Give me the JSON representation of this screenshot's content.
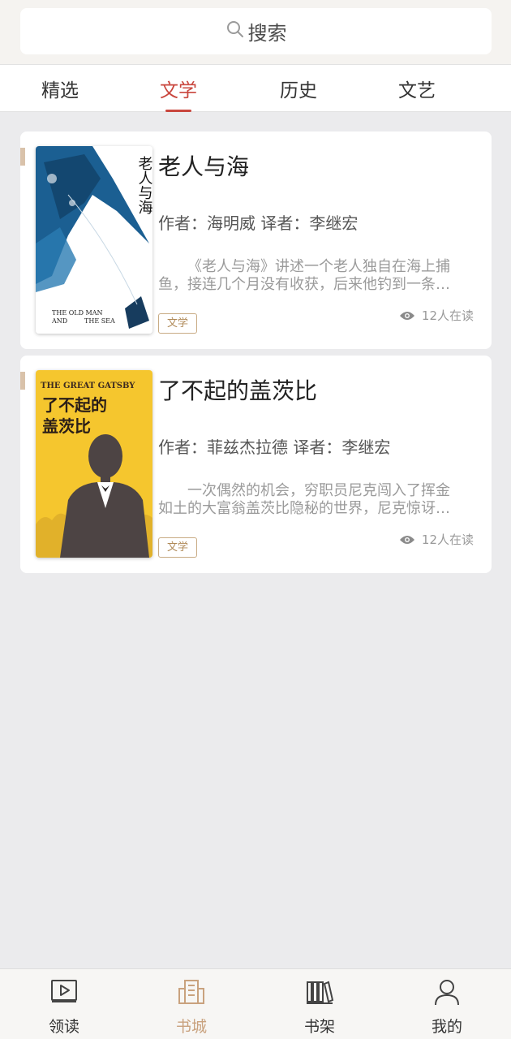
{
  "search": {
    "placeholder": "搜索",
    "icon": "search-icon"
  },
  "tabs": [
    {
      "label": "精选",
      "active": false
    },
    {
      "label": "文学",
      "active": true
    },
    {
      "label": "历史",
      "active": false
    },
    {
      "label": "文艺",
      "active": false
    }
  ],
  "books": [
    {
      "title": "老人与海",
      "meta": "作者：海明威  译者：李继宏",
      "description": "《老人与海》讲述一个老人独自在海上捕鱼，接连几个月没有收获，后来他钓到一条…",
      "tag": "文学",
      "readers": "12人在读",
      "cover": {
        "title": "老人与海",
        "english_title_line1": "THE OLD MAN",
        "english_title_line2": "AND",
        "english_title_line3": "THE SEA",
        "background": "#ffffff",
        "accent": "#1d5c8c"
      }
    },
    {
      "title": "了不起的盖茨比",
      "meta": "作者：菲兹杰拉德  译者：李继宏",
      "description": "一次偶然的机会，穷职员尼克闯入了挥金如土的大富翁盖茨比隐秘的世界，尼克惊讶…",
      "tag": "文学",
      "readers": "12人在读",
      "cover": {
        "english_title": "THE GREAT GATSBY",
        "title_line1": "了不起的",
        "title_line2": "盖茨比",
        "background": "#f5c62e",
        "accent": "#4d4444"
      }
    }
  ],
  "bottom_nav": [
    {
      "label": "领读",
      "icon": "play-book-icon",
      "active": false
    },
    {
      "label": "书城",
      "icon": "city-icon",
      "active": true
    },
    {
      "label": "书架",
      "icon": "bookshelf-icon",
      "active": false
    },
    {
      "label": "我的",
      "icon": "user-icon",
      "active": false
    }
  ],
  "colors": {
    "accent_red": "#c9463d",
    "accent_gold": "#c9a27e",
    "background": "#ebebed"
  }
}
